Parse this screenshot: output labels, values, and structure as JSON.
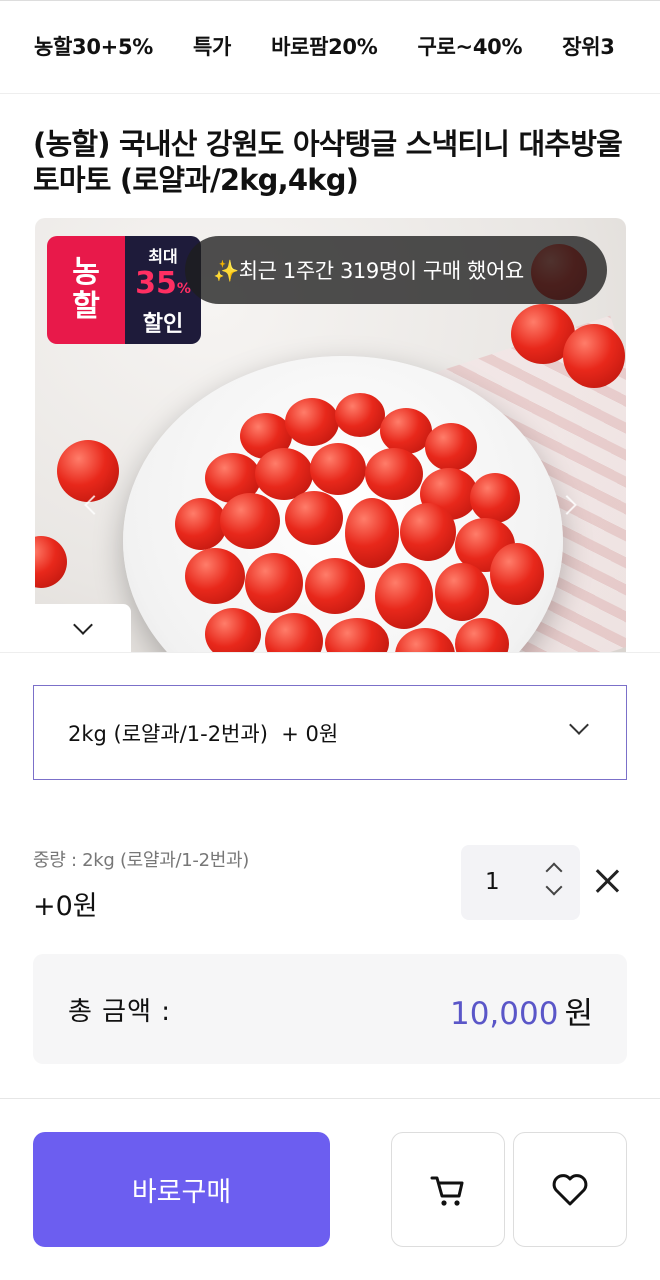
{
  "nav": {
    "tabs": [
      "농할30+5%",
      "특가",
      "바로팜20%",
      "구로~40%",
      "장위3"
    ]
  },
  "product": {
    "title": "(농할) 국내산 강원도 아삭탱글 스낵티니 대추방울토마토 (로얄과/2kg,4kg)",
    "badge": {
      "left_top": "농",
      "left_bottom": "할",
      "max": "최대",
      "percent": "35",
      "percent_sign": "%",
      "sale": "할인"
    },
    "buyers_notice": "✨최근 1주간 319명이 구매 했어요"
  },
  "option": {
    "selected": "2kg (로얄과/1-2번과)  + 0원"
  },
  "selection": {
    "label": "중량 : 2kg (로얄과/1-2번과)",
    "price": "+0원",
    "quantity": "1"
  },
  "total": {
    "label": "총 금액 :",
    "amount": "10,000",
    "unit": "원"
  },
  "actions": {
    "buy_label": "바로구매"
  },
  "colors": {
    "accent": "#6c5ef0",
    "price_accent": "#5a56c8",
    "badge_red": "#e8194a",
    "badge_dark": "#1e1b3a"
  },
  "icons": [
    "cart-icon",
    "heart-icon",
    "chevron-down-icon",
    "close-icon",
    "chevron-up-icon"
  ]
}
